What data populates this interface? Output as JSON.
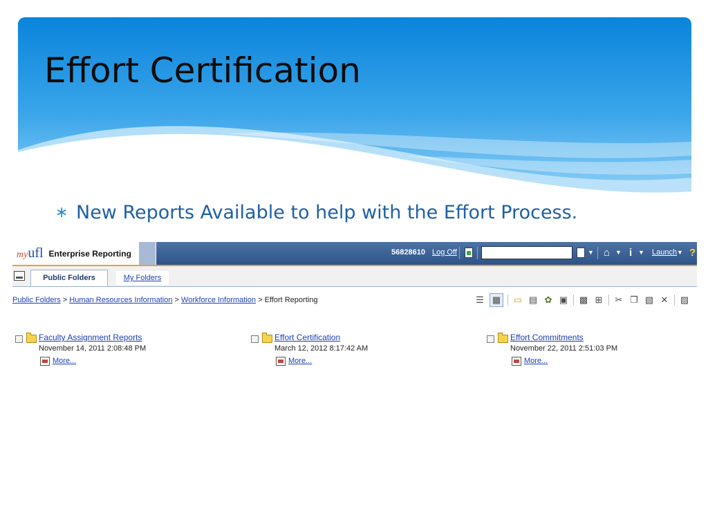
{
  "slide": {
    "title": "Effort Certification",
    "bullet": "New Reports Available to help with the Effort Process."
  },
  "colors": {
    "header_blue_top": "#0c86dc",
    "header_blue_bottom": "#7cc6f4",
    "bullet_text": "#1e5fa6",
    "bar_blue": "#2e5388",
    "link_blue": "#1a3fb5",
    "accent_orange": "#e8a03a"
  },
  "app": {
    "logo_prefix": "my",
    "logo_main": "ufl",
    "name": "Enterprise Reporting",
    "user_id": "56828610",
    "logoff_label": "Log Off",
    "search_value": "",
    "launch_label": "Launch",
    "help_glyph": "?"
  },
  "tabs": [
    {
      "label": "Public Folders",
      "active": true
    },
    {
      "label": "My Folders",
      "active": false
    }
  ],
  "breadcrumb": {
    "items": [
      "Public Folders",
      "Human Resources Information",
      "Workforce Information"
    ],
    "separator": ">",
    "current": "Effort Reporting"
  },
  "toolbar_icons": [
    "list-view-icon",
    "details-view-icon",
    "new-folder-icon",
    "new-report-icon",
    "new-agent-icon",
    "new-page-icon",
    "grid-icon",
    "tile-icon",
    "cut-icon",
    "copy-icon",
    "paste-icon",
    "delete-icon",
    "export-icon"
  ],
  "items": [
    {
      "name": "Faculty Assignment Reports",
      "date": "November 14, 2011 2:08:48 PM",
      "more_label": "More..."
    },
    {
      "name": "Effort Certification",
      "date": "March 12, 2012 8:17:42 AM",
      "more_label": "More..."
    },
    {
      "name": "Effort Commitments",
      "date": "November 22, 2011 2:51:03 PM",
      "more_label": "More..."
    }
  ]
}
